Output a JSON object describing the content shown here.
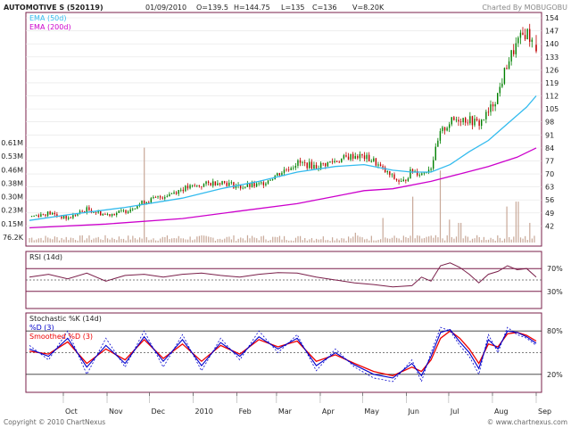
{
  "header": {
    "name": "AUTOMOTIVE S (520119)",
    "date": "01/09/2010",
    "open": "O=139.5",
    "high": "H=144.75",
    "low": "L=135",
    "close": "C=136",
    "volume": "V=8.20K",
    "charted_by": "Charted By MOBUGOBU"
  },
  "footer": {
    "copyright": "Copyright © 2010 ChartNexus",
    "site": "© www.chartnexus.com"
  },
  "colors": {
    "up": "#008000",
    "down": "#c00000",
    "ema50": "#33bbee",
    "ema200": "#cc00cc",
    "volume": "#c8a898",
    "rsi": "#7a1f4a",
    "stoch_k": "#0000cc",
    "stoch_smoothed": "#ee0000",
    "frame": "#7a1f4a"
  },
  "chart_data": [
    {
      "type": "candlestick",
      "panel": "price",
      "title": "AUTOMOTIVE S (520119)",
      "legend": [
        "EMA (50d)",
        "EMA (200d)"
      ],
      "x_tick_labels": [
        "Oct",
        "Nov",
        "Dec",
        "2010",
        "Feb",
        "Mar",
        "Apr",
        "May",
        "Jun",
        "Jul",
        "Aug",
        "Sep"
      ],
      "x_ticks": [
        "2009-10-01",
        "2009-11-01",
        "2009-12-01",
        "2010-01-01",
        "2010-02-01",
        "2010-03-01",
        "2010-04-01",
        "2010-05-01",
        "2010-06-01",
        "2010-07-01",
        "2010-08-01",
        "2010-09-01"
      ],
      "y_ticks_right": [
        154,
        147,
        140,
        133,
        126,
        119,
        112,
        105,
        98,
        91,
        84,
        77,
        70,
        63,
        56,
        49,
        42
      ],
      "ylim": [
        35,
        154
      ],
      "volume_axis_labels": [
        "0.61M",
        "0.53M",
        "0.46M",
        "0.38M",
        "0.30M",
        "0.23M",
        "0.15M",
        "76.2K"
      ],
      "volume_ylim": [
        0,
        0.61
      ],
      "ema_50": [
        [
          0,
          45
        ],
        [
          20,
          48
        ],
        [
          50,
          52
        ],
        [
          80,
          57
        ],
        [
          100,
          62
        ],
        [
          120,
          66
        ],
        [
          140,
          71
        ],
        [
          160,
          74
        ],
        [
          175,
          75
        ],
        [
          190,
          72
        ],
        [
          200,
          71
        ],
        [
          210,
          71
        ],
        [
          220,
          75
        ],
        [
          230,
          82
        ],
        [
          240,
          88
        ],
        [
          250,
          97
        ],
        [
          260,
          106
        ],
        [
          265,
          112
        ]
      ],
      "ema_200": [
        [
          0,
          41
        ],
        [
          40,
          43
        ],
        [
          80,
          46
        ],
        [
          110,
          50
        ],
        [
          140,
          54
        ],
        [
          160,
          58
        ],
        [
          175,
          61
        ],
        [
          190,
          62
        ],
        [
          210,
          66
        ],
        [
          225,
          70
        ],
        [
          240,
          74
        ],
        [
          255,
          79
        ],
        [
          265,
          84
        ]
      ],
      "close_path": [
        [
          0,
          47
        ],
        [
          10,
          49
        ],
        [
          20,
          46
        ],
        [
          30,
          51
        ],
        [
          40,
          48
        ],
        [
          50,
          50
        ],
        [
          60,
          55
        ],
        [
          70,
          58
        ],
        [
          80,
          62
        ],
        [
          90,
          64
        ],
        [
          100,
          66
        ],
        [
          110,
          63
        ],
        [
          120,
          64
        ],
        [
          130,
          70
        ],
        [
          140,
          76
        ],
        [
          150,
          74
        ],
        [
          160,
          77
        ],
        [
          170,
          80
        ],
        [
          175,
          79
        ],
        [
          180,
          77
        ],
        [
          185,
          72
        ],
        [
          190,
          68
        ],
        [
          195,
          65
        ],
        [
          200,
          72
        ],
        [
          205,
          70
        ],
        [
          210,
          74
        ],
        [
          215,
          92
        ],
        [
          220,
          98
        ],
        [
          225,
          100
        ],
        [
          230,
          99
        ],
        [
          235,
          97
        ],
        [
          240,
          103
        ],
        [
          245,
          113
        ],
        [
          250,
          130
        ],
        [
          255,
          140
        ],
        [
          260,
          147
        ],
        [
          265,
          136
        ]
      ],
      "volume_spikes": [
        [
          60,
          0.58
        ],
        [
          170,
          0.06
        ],
        [
          185,
          0.15
        ],
        [
          200,
          0.28
        ],
        [
          215,
          0.44
        ],
        [
          220,
          0.14
        ],
        [
          225,
          0.12
        ],
        [
          250,
          0.22
        ],
        [
          255,
          0.25
        ],
        [
          262,
          0.12
        ]
      ],
      "last_candle": {
        "open": 139.5,
        "high": 144.75,
        "low": 135,
        "close": 136,
        "volume": "8.20K"
      }
    },
    {
      "type": "line",
      "panel": "rsi",
      "title": "RSI (14d)",
      "y_tick_labels": [
        "70%",
        "30%"
      ],
      "levels": [
        70,
        50,
        30
      ],
      "ylim": [
        0,
        100
      ],
      "series": [
        {
          "name": "RSI (14d)",
          "values": [
            [
              0,
              55
            ],
            [
              10,
              60
            ],
            [
              20,
              52
            ],
            [
              30,
              62
            ],
            [
              40,
              48
            ],
            [
              50,
              58
            ],
            [
              60,
              60
            ],
            [
              70,
              55
            ],
            [
              80,
              60
            ],
            [
              90,
              62
            ],
            [
              100,
              58
            ],
            [
              110,
              55
            ],
            [
              120,
              60
            ],
            [
              130,
              63
            ],
            [
              140,
              62
            ],
            [
              150,
              55
            ],
            [
              160,
              50
            ],
            [
              170,
              45
            ],
            [
              180,
              42
            ],
            [
              190,
              38
            ],
            [
              200,
              40
            ],
            [
              205,
              55
            ],
            [
              210,
              48
            ],
            [
              215,
              75
            ],
            [
              220,
              80
            ],
            [
              225,
              72
            ],
            [
              230,
              60
            ],
            [
              235,
              45
            ],
            [
              240,
              60
            ],
            [
              245,
              65
            ],
            [
              250,
              75
            ],
            [
              255,
              68
            ],
            [
              260,
              70
            ],
            [
              265,
              55
            ]
          ]
        }
      ]
    },
    {
      "type": "line",
      "panel": "stochastic",
      "title": "Stochastic %K (14d)",
      "y_tick_labels": [
        "80%",
        "20%"
      ],
      "levels": [
        80,
        50,
        20
      ],
      "ylim": [
        0,
        100
      ],
      "series": [
        {
          "name": "Stochastic %K (14d)",
          "values": [
            [
              0,
              60
            ],
            [
              10,
              40
            ],
            [
              20,
              80
            ],
            [
              30,
              20
            ],
            [
              40,
              70
            ],
            [
              50,
              30
            ],
            [
              60,
              80
            ],
            [
              70,
              30
            ],
            [
              80,
              75
            ],
            [
              90,
              25
            ],
            [
              100,
              70
            ],
            [
              110,
              40
            ],
            [
              120,
              80
            ],
            [
              130,
              50
            ],
            [
              140,
              75
            ],
            [
              150,
              25
            ],
            [
              160,
              55
            ],
            [
              170,
              30
            ],
            [
              180,
              15
            ],
            [
              190,
              10
            ],
            [
              200,
              40
            ],
            [
              205,
              10
            ],
            [
              210,
              50
            ],
            [
              215,
              85
            ],
            [
              220,
              80
            ],
            [
              225,
              60
            ],
            [
              230,
              45
            ],
            [
              235,
              20
            ],
            [
              240,
              75
            ],
            [
              245,
              50
            ],
            [
              250,
              85
            ],
            [
              255,
              75
            ],
            [
              260,
              70
            ],
            [
              265,
              60
            ]
          ]
        },
        {
          "name": "%D (3)",
          "values": [
            [
              0,
              55
            ],
            [
              10,
              45
            ],
            [
              20,
              70
            ],
            [
              30,
              30
            ],
            [
              40,
              60
            ],
            [
              50,
              35
            ],
            [
              60,
              72
            ],
            [
              70,
              38
            ],
            [
              80,
              68
            ],
            [
              90,
              32
            ],
            [
              100,
              64
            ],
            [
              110,
              45
            ],
            [
              120,
              72
            ],
            [
              130,
              55
            ],
            [
              140,
              70
            ],
            [
              150,
              32
            ],
            [
              160,
              50
            ],
            [
              170,
              33
            ],
            [
              180,
              20
            ],
            [
              190,
              15
            ],
            [
              200,
              35
            ],
            [
              205,
              18
            ],
            [
              210,
              45
            ],
            [
              215,
              78
            ],
            [
              220,
              82
            ],
            [
              225,
              65
            ],
            [
              230,
              50
            ],
            [
              235,
              28
            ],
            [
              240,
              68
            ],
            [
              245,
              55
            ],
            [
              250,
              80
            ],
            [
              255,
              78
            ],
            [
              260,
              72
            ],
            [
              265,
              63
            ]
          ]
        },
        {
          "name": "Smoothed %D (3)",
          "values": [
            [
              0,
              52
            ],
            [
              10,
              48
            ],
            [
              20,
              65
            ],
            [
              30,
              35
            ],
            [
              40,
              55
            ],
            [
              50,
              40
            ],
            [
              60,
              68
            ],
            [
              70,
              42
            ],
            [
              80,
              62
            ],
            [
              90,
              38
            ],
            [
              100,
              60
            ],
            [
              110,
              48
            ],
            [
              120,
              68
            ],
            [
              130,
              58
            ],
            [
              140,
              66
            ],
            [
              150,
              38
            ],
            [
              160,
              47
            ],
            [
              170,
              35
            ],
            [
              180,
              24
            ],
            [
              190,
              18
            ],
            [
              200,
              30
            ],
            [
              205,
              24
            ],
            [
              210,
              40
            ],
            [
              215,
              70
            ],
            [
              220,
              80
            ],
            [
              225,
              70
            ],
            [
              230,
              55
            ],
            [
              235,
              35
            ],
            [
              240,
              62
            ],
            [
              245,
              58
            ],
            [
              250,
              76
            ],
            [
              255,
              78
            ],
            [
              260,
              74
            ],
            [
              265,
              66
            ]
          ]
        }
      ]
    }
  ]
}
